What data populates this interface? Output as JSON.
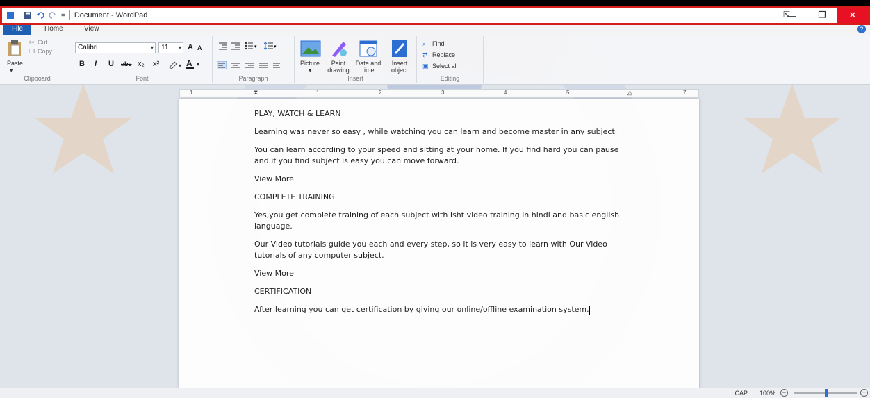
{
  "window": {
    "title": "Document - WordPad",
    "qat_separator": "=",
    "minimize": "—",
    "restore": "❐",
    "close": "✕"
  },
  "tabs": [
    {
      "label": "File"
    },
    {
      "label": "Home"
    },
    {
      "label": "View"
    }
  ],
  "ribbon": {
    "clipboard": {
      "group_label": "Clipboard",
      "paste": "Paste",
      "cut": "Cut",
      "copy": "Copy"
    },
    "font": {
      "group_label": "Font",
      "font_name": "Calibri",
      "font_size": "11",
      "bold": "B",
      "italic": "I",
      "underline": "U",
      "strike": "abc",
      "sub": "x₂",
      "sup": "x²",
      "grow": "A",
      "shrink": "A"
    },
    "paragraph": {
      "group_label": "Paragraph"
    },
    "insert": {
      "group_label": "Insert",
      "picture": "Picture",
      "paint_drawing": "Paint drawing",
      "date_time": "Date and time",
      "insert_object": "Insert object"
    },
    "editing": {
      "group_label": "Editing",
      "find": "Find",
      "replace": "Replace",
      "select_all": "Select all"
    }
  },
  "ruler": {
    "numbers": [
      "1",
      "1",
      "2",
      "3",
      "4",
      "5",
      "7"
    ]
  },
  "document": {
    "paragraphs": [
      "PLAY, WATCH & LEARN",
      "Learning was never so easy , while watching you can learn and become master in any subject.",
      "You can learn according to your speed and sitting at your home. If you find hard you can pause and if you find subject is easy you can move forward.",
      "View More",
      "COMPLETE TRAINING",
      "Yes,you get complete training of each subject with Isht video training in hindi and basic english language.",
      "Our Video tutorials guide you each and every step, so it is very easy to learn with Our Video tutorials of any computer subject.",
      "View More",
      "CERTIFICATION",
      "After learning you can get certification by giving our online/offline examination system."
    ]
  },
  "status": {
    "cap": "CAP",
    "zoom": "100%",
    "zoom_fraction": 0.5
  },
  "colors": {
    "accent": "#1e5fb4",
    "close": "#e81123",
    "highlight_border": "#d71c1c"
  },
  "icons": [
    "save-icon",
    "undo-icon",
    "redo-icon",
    "paste-icon",
    "cut-icon",
    "copy-icon",
    "picture-icon",
    "paint-icon",
    "datetime-icon",
    "object-icon",
    "find-icon",
    "replace-icon",
    "selectall-icon"
  ]
}
